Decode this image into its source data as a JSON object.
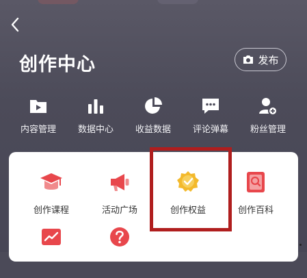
{
  "header": {
    "title": "创作中心",
    "publish_label": "发布"
  },
  "tools": [
    {
      "label": "内容管理",
      "icon": "play-folder-icon"
    },
    {
      "label": "数据中心",
      "icon": "bar-chart-icon"
    },
    {
      "label": "收益数据",
      "icon": "pie-chart-icon"
    },
    {
      "label": "评论弹幕",
      "icon": "comment-icon"
    },
    {
      "label": "粉丝管理",
      "icon": "user-add-icon"
    }
  ],
  "features": [
    {
      "label": "创作课程",
      "icon": "graduation-cap-icon"
    },
    {
      "label": "活动广场",
      "icon": "megaphone-icon"
    },
    {
      "label": "创作权益",
      "icon": "medal-icon"
    },
    {
      "label": "创作百科",
      "icon": "encyclopedia-icon"
    },
    {
      "label": "",
      "icon": "trend-chart-icon"
    },
    {
      "label": "",
      "icon": "help-icon"
    }
  ],
  "colors": {
    "background": "#4b4a58",
    "card": "#ffffff",
    "highlight": "#b01e1e",
    "icon_red": "#e8474c",
    "icon_gold": "#f3b92b"
  }
}
